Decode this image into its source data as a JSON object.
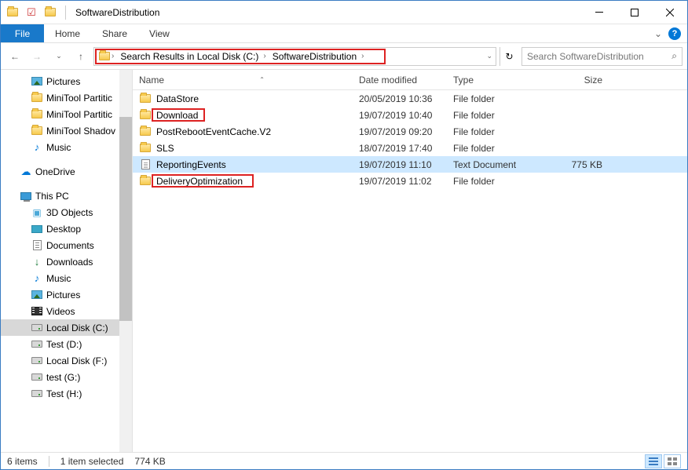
{
  "title": "SoftwareDistribution",
  "ribbon": {
    "file": "File",
    "home": "Home",
    "share": "Share",
    "view": "View"
  },
  "breadcrumbs": {
    "b1": "Search Results in Local Disk (C:)",
    "b2": "SoftwareDistribution"
  },
  "search": {
    "placeholder": "Search SoftwareDistribution"
  },
  "tree": {
    "pictures": "Pictures",
    "mt1": "MiniTool Partitic",
    "mt2": "MiniTool Partitic",
    "mt3": "MiniTool Shadov",
    "music": "Music",
    "onedrive": "OneDrive",
    "thispc": "This PC",
    "obj3d": "3D Objects",
    "desktop": "Desktop",
    "documents": "Documents",
    "downloads": "Downloads",
    "music2": "Music",
    "pictures2": "Pictures",
    "videos": "Videos",
    "localc": "Local Disk (C:)",
    "testd": "Test (D:)",
    "localf": "Local Disk (F:)",
    "testg": "test (G:)",
    "testh": "Test (H:)"
  },
  "cols": {
    "name": "Name",
    "date": "Date modified",
    "type": "Type",
    "size": "Size"
  },
  "rows": [
    {
      "name": "DataStore",
      "date": "20/05/2019 10:36",
      "type": "File folder",
      "size": "",
      "icon": "folder",
      "sel": false,
      "hl": false
    },
    {
      "name": "Download",
      "date": "19/07/2019 10:40",
      "type": "File folder",
      "size": "",
      "icon": "folder",
      "sel": false,
      "hl": true,
      "hlw": 68
    },
    {
      "name": "PostRebootEventCache.V2",
      "date": "19/07/2019 09:20",
      "type": "File folder",
      "size": "",
      "icon": "folder",
      "sel": false,
      "hl": false
    },
    {
      "name": "SLS",
      "date": "18/07/2019 17:40",
      "type": "File folder",
      "size": "",
      "icon": "folder",
      "sel": false,
      "hl": false
    },
    {
      "name": "ReportingEvents",
      "date": "19/07/2019 11:10",
      "type": "Text Document",
      "size": "775 KB",
      "icon": "txt",
      "sel": true,
      "hl": false
    },
    {
      "name": "DeliveryOptimization",
      "date": "19/07/2019 11:02",
      "type": "File folder",
      "size": "",
      "icon": "folder",
      "sel": false,
      "hl": true,
      "hlw": 130
    }
  ],
  "status": {
    "count": "6 items",
    "sel": "1 item selected",
    "size": "774 KB"
  }
}
